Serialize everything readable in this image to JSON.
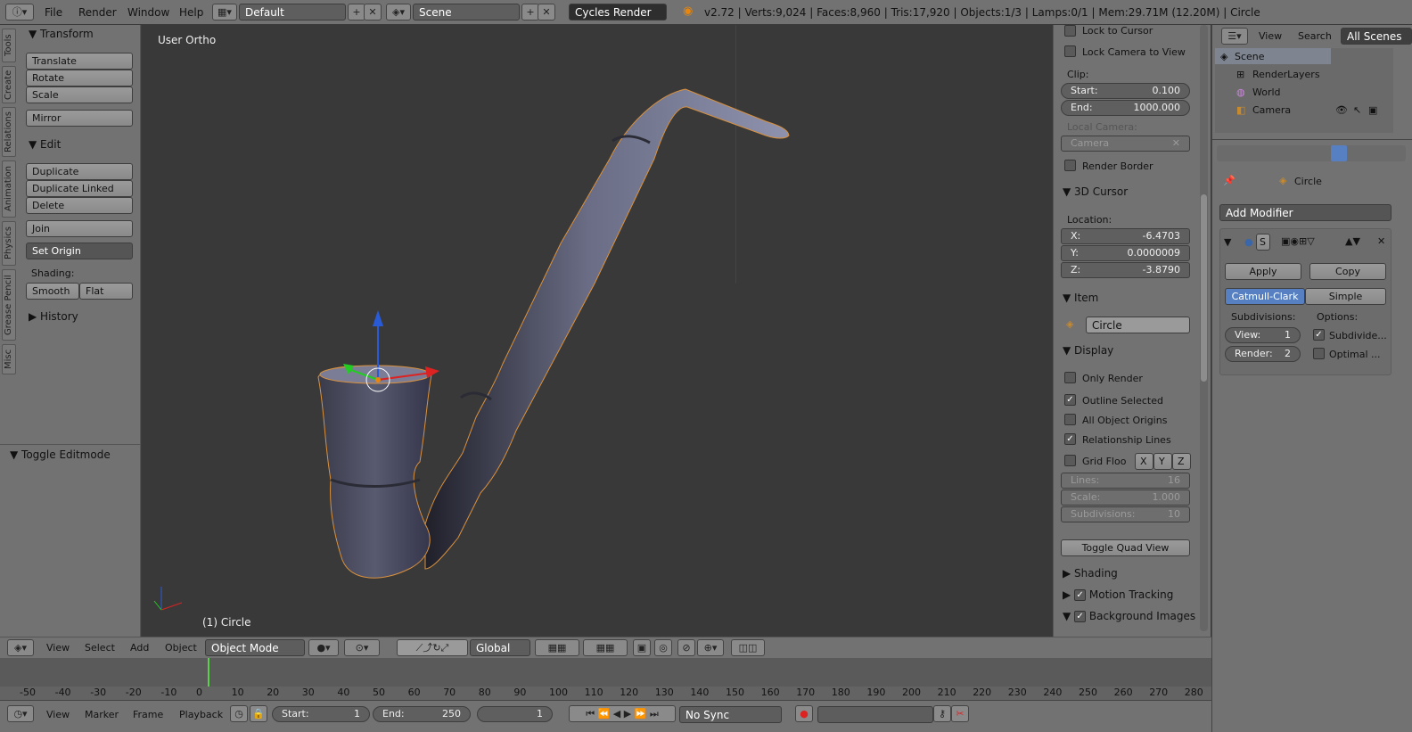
{
  "topbar": {
    "menus": [
      "File",
      "Render",
      "Window",
      "Help"
    ],
    "layout": "Default",
    "scene": "Scene",
    "engine": "Cycles Render",
    "stats": "v2.72 | Verts:9,024 | Faces:8,960 | Tris:17,920 | Objects:1/3 | Lamps:0/1 | Mem:29.71M (12.20M) | Circle"
  },
  "toolshelf": {
    "tabs": [
      "Tools",
      "Create",
      "Relations",
      "Animation",
      "Physics",
      "Grease Pencil",
      "Misc"
    ],
    "transform": {
      "header": "Transform",
      "buttons": [
        "Translate",
        "Rotate",
        "Scale",
        "Mirror"
      ]
    },
    "edit": {
      "header": "Edit",
      "buttons": [
        "Duplicate",
        "Duplicate Linked",
        "Delete",
        "Join"
      ],
      "set_origin": "Set Origin",
      "shading_label": "Shading:",
      "smooth": "Smooth",
      "flat": "Flat"
    },
    "history": "History",
    "toggle_editmode": "Toggle Editmode"
  },
  "viewport": {
    "view_name": "User Ortho",
    "object_label": "(1) Circle"
  },
  "npanel": {
    "lock_to_cursor": "Lock to Cursor",
    "lock_camera": "Lock Camera to View",
    "clip_label": "Clip:",
    "clip_start_label": "Start:",
    "clip_start": "0.100",
    "clip_end_label": "End:",
    "clip_end": "1000.000",
    "local_camera_label": "Local Camera:",
    "local_camera": "Camera",
    "render_border": "Render Border",
    "cursor_header": "3D Cursor",
    "location_label": "Location:",
    "x_label": "X:",
    "x": "-6.4703",
    "y_label": "Y:",
    "y": "0.0000009",
    "z_label": "Z:",
    "z": "-3.8790",
    "item_header": "Item",
    "item_name": "Circle",
    "display_header": "Display",
    "only_render": "Only Render",
    "outline_selected": "Outline Selected",
    "all_origins": "All Object Origins",
    "relationship_lines": "Relationship Lines",
    "grid_floor": "Grid Floo",
    "axis_x": "X",
    "axis_y": "Y",
    "axis_z": "Z",
    "lines_label": "Lines:",
    "lines": "16",
    "scale_label": "Scale:",
    "scale": "1.000",
    "subdiv_label": "Subdivisions:",
    "subdiv": "10",
    "toggle_quad": "Toggle Quad View",
    "shading_header": "Shading",
    "motion_header": "Motion Tracking",
    "background_header": "Background Images"
  },
  "outliner": {
    "view": "View",
    "search": "Search",
    "all_scenes": "All Scenes",
    "items": [
      "Scene",
      "RenderLayers",
      "World",
      "Camera"
    ]
  },
  "properties": {
    "object_name": "Circle",
    "add_modifier": "Add Modifier",
    "mod_s": "S",
    "apply": "Apply",
    "copy": "Copy",
    "catmull": "Catmull-Clark",
    "simple": "Simple",
    "subdivisions_label": "Subdivisions:",
    "options_label": "Options:",
    "view_label": "View:",
    "view_val": "1",
    "render_label": "Render:",
    "render_val": "2",
    "subdivide": "Subdivide...",
    "optimal": "Optimal ..."
  },
  "viewheader": {
    "menus": [
      "View",
      "Select",
      "Add",
      "Object"
    ],
    "mode": "Object Mode",
    "orientation": "Global"
  },
  "timeline": {
    "ticks": [
      "-50",
      "-40",
      "-30",
      "-20",
      "-10",
      "0",
      "10",
      "20",
      "30",
      "40",
      "50",
      "60",
      "70",
      "80",
      "90",
      "100",
      "110",
      "120",
      "130",
      "140",
      "150",
      "160",
      "170",
      "180",
      "190",
      "200",
      "210",
      "220",
      "230",
      "240",
      "250",
      "260",
      "270",
      "280"
    ],
    "menus": [
      "View",
      "Marker",
      "Frame",
      "Playback"
    ],
    "start_label": "Start:",
    "start": "1",
    "end_label": "End:",
    "end": "250",
    "current": "1",
    "sync": "No Sync"
  }
}
